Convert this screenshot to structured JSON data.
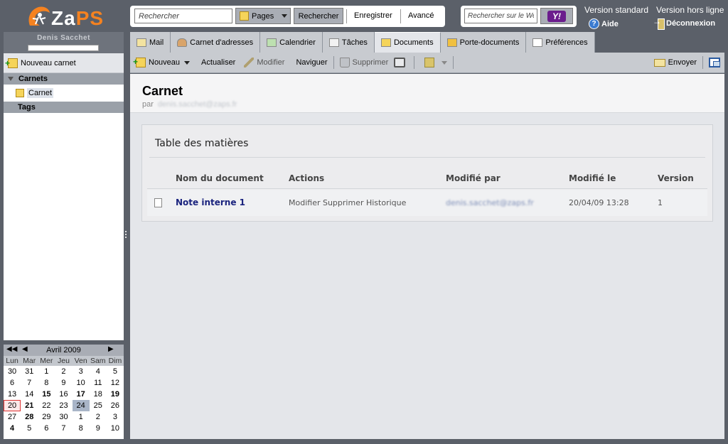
{
  "header": {
    "logo_text": "ZaPS",
    "search_placeholder": "Rechercher",
    "pages_label": "Pages",
    "search_button": "Rechercher",
    "save_label": "Enregistrer",
    "advanced_label": "Avancé",
    "web_search_placeholder": "Rechercher sur le Web",
    "yahoo_label": "Y!",
    "standard_version": "Version standard",
    "offline_version": "Version hors ligne",
    "help": "Aide",
    "logout": "Déconnexion"
  },
  "sidebar": {
    "user_name": "Denis Sacchet",
    "new_notebook": "Nouveau carnet",
    "notebooks_header": "Carnets",
    "notebooks": [
      {
        "label": "Carnet"
      }
    ],
    "tags_header": "Tags"
  },
  "tabs": [
    {
      "label": "Mail",
      "icon": "mail-icon"
    },
    {
      "label": "Carnet d'adresses",
      "icon": "contacts-icon"
    },
    {
      "label": "Calendrier",
      "icon": "calendar-icon"
    },
    {
      "label": "Tâches",
      "icon": "tasks-icon"
    },
    {
      "label": "Documents",
      "icon": "documents-icon",
      "active": true
    },
    {
      "label": "Porte-documents",
      "icon": "briefcase-icon"
    },
    {
      "label": "Préférences",
      "icon": "preferences-icon"
    }
  ],
  "toolbar": {
    "new": "Nouveau",
    "refresh": "Actualiser",
    "edit": "Modifier",
    "browse": "Naviguer",
    "delete": "Supprimer",
    "send": "Envoyer"
  },
  "page": {
    "title": "Carnet",
    "by_label": "par",
    "author": "denis.sacchet@zaps.fr"
  },
  "toc": {
    "title": "Table des matières",
    "columns": [
      "Nom du document",
      "Actions",
      "Modifié par",
      "Modifié le",
      "Version"
    ],
    "rows": [
      {
        "name": "Note interne 1",
        "actions": "Modifier Supprimer Historique",
        "modified_by": "denis.sacchet@zaps.fr",
        "modified_on": "20/04/09 13:28",
        "version": "1"
      }
    ]
  },
  "calendar": {
    "month": "Avril 2009",
    "days": [
      "Lun",
      "Mar",
      "Mer",
      "Jeu",
      "Ven",
      "Sam",
      "Dim"
    ],
    "weeks": [
      [
        "30",
        "31",
        "1",
        "2",
        "3",
        "4",
        "5"
      ],
      [
        "6",
        "7",
        "8",
        "9",
        "10",
        "11",
        "12"
      ],
      [
        "13",
        "14",
        "15",
        "16",
        "17",
        "18",
        "19"
      ],
      [
        "20",
        "21",
        "22",
        "23",
        "24",
        "25",
        "26"
      ],
      [
        "27",
        "28",
        "29",
        "30",
        "1",
        "2",
        "3"
      ],
      [
        "4",
        "5",
        "6",
        "7",
        "8",
        "9",
        "10"
      ]
    ],
    "bold_days": [
      "15",
      "17",
      "19",
      "21",
      "28"
    ],
    "today": "20",
    "selected": "24"
  }
}
